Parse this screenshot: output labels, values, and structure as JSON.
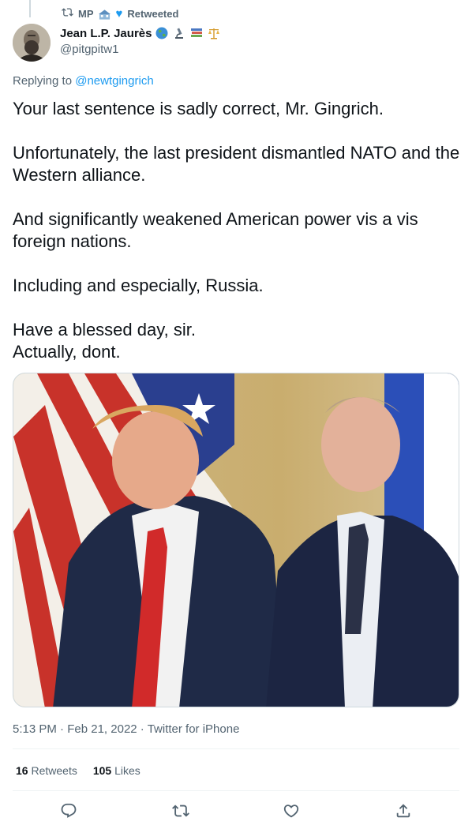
{
  "retweet_context": {
    "user": "MP",
    "label": "Retweeted"
  },
  "author": {
    "name": "Jean L.P. Jaurès",
    "handle": "@pitgpitw1",
    "emojis": [
      "globe-emoji",
      "microscope-emoji",
      "books-emoji",
      "scales-emoji"
    ]
  },
  "reply": {
    "prefix": "Replying to",
    "target": "@newtgingrich"
  },
  "tweet": {
    "paragraphs": [
      "Your last sentence is sadly correct, Mr. Gingrich.",
      "Unfortunately, the last president dismantled NATO and the Western alliance.",
      "And significantly weakened American power vis a vis foreign nations.",
      "Including and especially, Russia.",
      "Have a blessed day, sir.\nActually, dont."
    ]
  },
  "meta": {
    "time": "5:13 PM",
    "date": "Feb 21, 2022",
    "source": "Twitter for iPhone",
    "separator": "·"
  },
  "stats": {
    "retweets_count": "16",
    "retweets_label": "Retweets",
    "likes_count": "105",
    "likes_label": "Likes"
  },
  "colors": {
    "accent": "#1d9bf0",
    "secondary_text": "#536471",
    "primary_text": "#0f1419"
  },
  "actions": [
    "reply-icon",
    "retweet-icon",
    "like-icon",
    "share-icon"
  ]
}
